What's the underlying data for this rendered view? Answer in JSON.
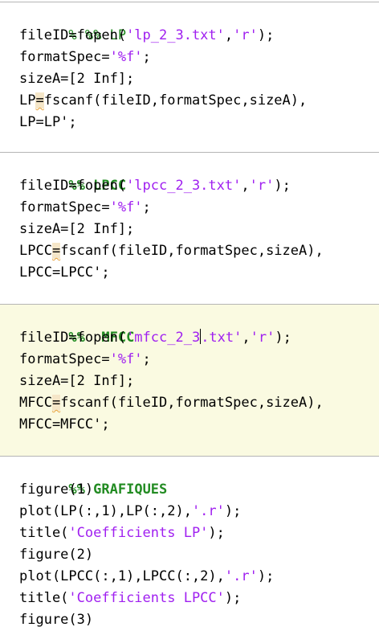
{
  "cells": [
    {
      "header": {
        "marker": "% %%",
        "title": "LP"
      },
      "lines": [
        {
          "a": "fileID=fopen(",
          "s1": "'lp_2_3.txt'",
          "b": ",",
          "s2": "'r'",
          "c": ");"
        },
        {
          "a": "formatSpec=",
          "s1": "'%f'",
          "c": ";"
        },
        {
          "a": "sizeA=[2 Inf];"
        },
        {
          "lhs": "LP",
          "eq": "=",
          "rest": "fscanf(fileID,formatSpec,sizeA),"
        },
        {
          "a": "LP=LP';"
        }
      ]
    },
    {
      "header": {
        "marker": "%%",
        "title": "LPCC"
      },
      "lines": [
        {
          "a": "fileID=fopen(",
          "s1": "'lpcc_2_3.txt'",
          "b": ",",
          "s2": "'r'",
          "c": ");"
        },
        {
          "a": "formatSpec=",
          "s1": "'%f'",
          "c": ";"
        },
        {
          "a": "sizeA=[2 Inf];"
        },
        {
          "lhs": "LPCC",
          "eq": "=",
          "rest": "fscanf(fileID,formatSpec,sizeA),"
        },
        {
          "a": "LPCC=LPCC';"
        }
      ]
    },
    {
      "header": {
        "marker": "%%",
        "title": " MFCC"
      },
      "lines": [
        {
          "a": "fileID=fopen(",
          "s1a": "'mfcc_2_3",
          "s1b": ".txt'",
          "b": ",",
          "s2": "'r'",
          "c": ");"
        },
        {
          "a": "formatSpec=",
          "s1": "'%f'",
          "c": ";"
        },
        {
          "a": "sizeA=[2 Inf];"
        },
        {
          "lhs": "MFCC",
          "eq": "=",
          "rest": "fscanf(fileID,formatSpec,sizeA),"
        },
        {
          "a": "MFCC=MFCC';"
        }
      ]
    },
    {
      "header": {
        "marker": "%%",
        "title": "GRAFIQUES"
      },
      "lines": [
        {
          "a": "figure(1)"
        },
        {
          "a": "plot(LP(:,1),LP(:,2),",
          "s1": "'.r'",
          "c": ");"
        },
        {
          "a": "title(",
          "s1": "'Coefficients LP'",
          "c": ");"
        },
        {
          "a": "figure(2)"
        },
        {
          "a": "plot(LPCC(:,1),LPCC(:,2),",
          "s1": "'.r'",
          "c": ");"
        },
        {
          "a": "title(",
          "s1": "'Coefficients LPCC'",
          "c": ");"
        },
        {
          "a": "figure(3)"
        }
      ]
    }
  ],
  "colors": {
    "comment": "#228b22",
    "string": "#a020f0",
    "active_cell_bg": "#fafae1",
    "cell_divider": "#b5b5b5",
    "warning_squiggle": "#e8a33c"
  }
}
